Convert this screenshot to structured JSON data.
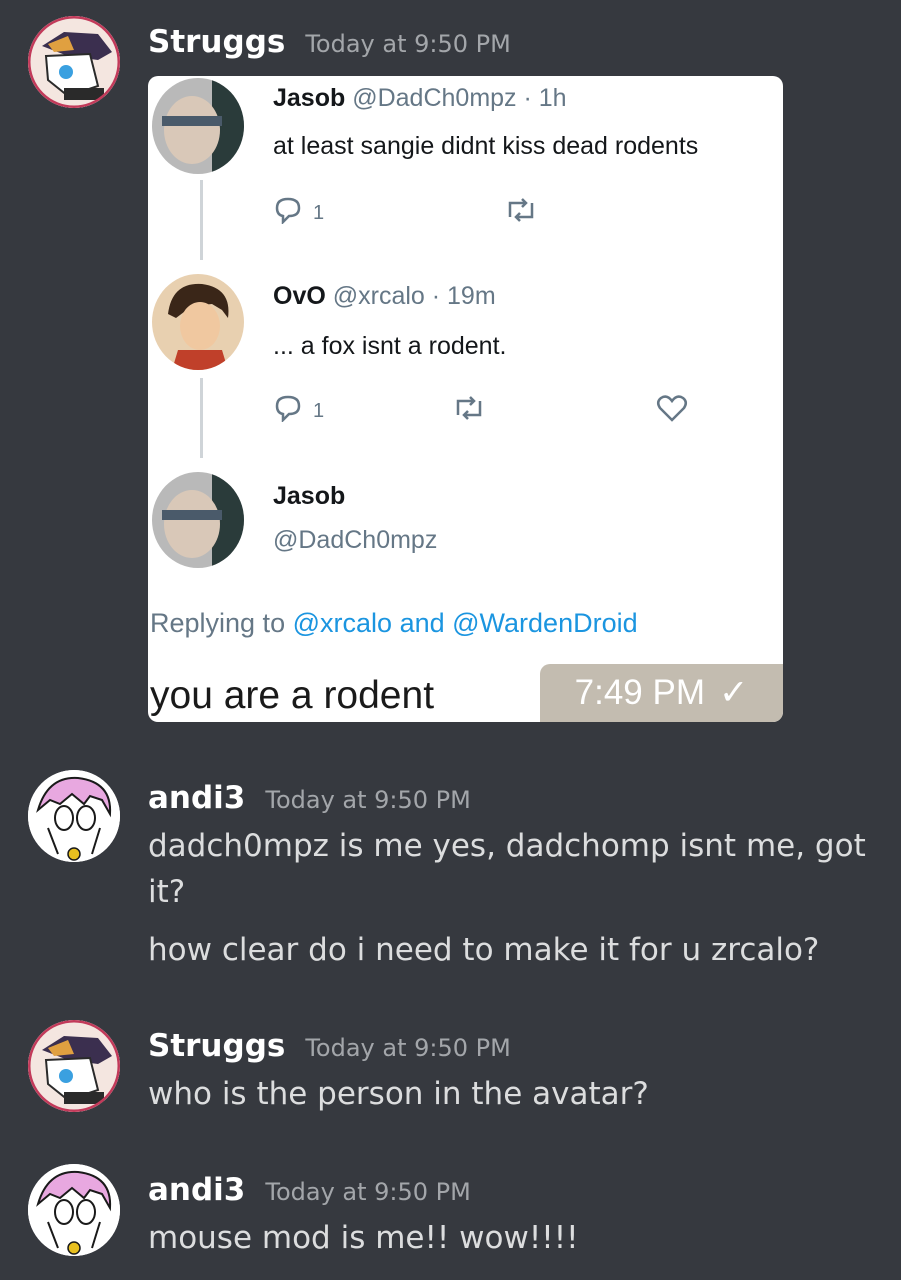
{
  "messages": [
    {
      "user": "Struggs",
      "time": "Today at 9:50 PM"
    },
    {
      "user": "andi3",
      "time": "Today at 9:50 PM",
      "lines": [
        "dadch0mpz is me yes, dadchomp isnt me, got",
        "it?",
        "how clear do i need to make it for u zrcalo?"
      ]
    },
    {
      "user": "Struggs",
      "time": "Today at 9:50 PM",
      "lines": [
        "who is the person in the avatar?"
      ]
    },
    {
      "user": "andi3",
      "time": "Today at 9:50 PM",
      "lines": [
        "mouse mod is me!! wow!!!!"
      ]
    }
  ],
  "embed": {
    "tweet1": {
      "name": "Jasob",
      "handle": "@DadCh0mpz · 1h",
      "text": "at least sangie didnt kiss dead rodents",
      "replies": "1"
    },
    "tweet2": {
      "name": "OvO",
      "handle": "@xrcalo · 19m",
      "text": "... a fox isnt a rodent.",
      "replies": "1"
    },
    "tweet3": {
      "name": "Jasob",
      "handle": "@DadCh0mpz"
    },
    "replying_prefix": "Replying to",
    "replying_user1": "@xrcalo",
    "replying_and": "and",
    "replying_user2": "@WardenDroid",
    "overlay_text": "you are a rodent",
    "overlay_time": "7:49 PM",
    "overlay_check": "✓"
  },
  "icons": {
    "reply": "reply-icon",
    "retweet": "retweet-icon",
    "like": "heart-icon",
    "avatar_struggs": "fox-avatar",
    "avatar_andi": "sketch-avatar"
  }
}
